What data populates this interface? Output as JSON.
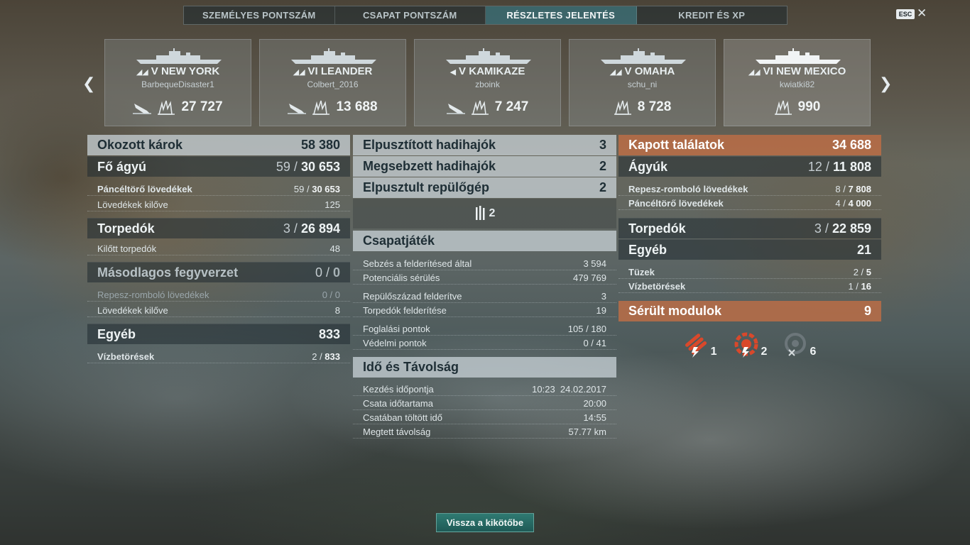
{
  "tabs": [
    {
      "label": "SZEMÉLYES PONTSZÁM",
      "active": false
    },
    {
      "label": "CSAPAT PONTSZÁM",
      "active": false
    },
    {
      "label": "RÉSZLETES JELENTÉS",
      "active": true
    },
    {
      "label": "KREDIT ÉS XP",
      "active": false
    }
  ],
  "esc_label": "ESC",
  "close_glyph": "✕",
  "ships": [
    {
      "tier": "V",
      "name": "NEW YORK",
      "player": "BarbequeDisaster1",
      "damage": "27 727",
      "sunk_icon": true,
      "class_icon": "battleship-icon"
    },
    {
      "tier": "VI",
      "name": "LEANDER",
      "player": "Colbert_2016",
      "damage": "13 688",
      "sunk_icon": true,
      "class_icon": "cruiser-icon"
    },
    {
      "tier": "V",
      "name": "KAMIKAZE",
      "player": "zboink",
      "damage": "7 247",
      "sunk_icon": true,
      "class_icon": "destroyer-icon"
    },
    {
      "tier": "V",
      "name": "OMAHA",
      "player": "schu_ni",
      "damage": "8 728",
      "sunk_icon": false,
      "class_icon": "cruiser-icon"
    },
    {
      "tier": "VI",
      "name": "NEW MEXICO",
      "player": "kwiatki82",
      "damage": "990",
      "sunk_icon": false,
      "class_icon": "battleship-icon"
    }
  ],
  "left": {
    "dealt": {
      "label": "Okozott károk",
      "value": "58 380"
    },
    "main_guns": {
      "label": "Fő ágyú",
      "hits": "59",
      "damage": "30 653"
    },
    "ap_shells": {
      "label": "Páncéltörő lövedékek",
      "hits": "59",
      "damage": "30 653"
    },
    "shells_fired": {
      "label": "Lövedékek kilőve",
      "value": "125"
    },
    "torpedoes": {
      "label": "Torpedók",
      "hits": "3",
      "damage": "26 894"
    },
    "torps_fired": {
      "label": "Kilőtt torpedók",
      "value": "48"
    },
    "secondary": {
      "label": "Másodlagos fegyverzet",
      "hits": "0",
      "damage": "0"
    },
    "he_shells": {
      "label": "Repesz-romboló lövedékek",
      "hits": "0",
      "damage": "0"
    },
    "sec_fired": {
      "label": "Lövedékek kilőve",
      "value": "8"
    },
    "other": {
      "label": "Egyéb",
      "value": "833"
    },
    "flooding": {
      "label": "Vízbetörések",
      "hits": "2",
      "damage": "833"
    }
  },
  "middle": {
    "ships_destroyed": {
      "label": "Elpusztított hadihajók",
      "value": "3"
    },
    "ships_damaged": {
      "label": "Megsebzett hadihajók",
      "value": "2"
    },
    "planes_destroyed": {
      "label": "Elpusztult repülőgép",
      "value": "2"
    },
    "plane_icon_count": "2",
    "teamplay": {
      "label": "Csapatjáték"
    },
    "spotting_damage": {
      "label": "Sebzés a felderítésed által",
      "value": "3 594"
    },
    "potential_damage": {
      "label": "Potenciális sérülés",
      "value": "479 769"
    },
    "squadrons_spotted": {
      "label": "Repülőszázad felderítve",
      "value": "3"
    },
    "torps_spotted": {
      "label": "Torpedók felderítése",
      "value": "19"
    },
    "capture_points": {
      "label": "Foglalási pontok",
      "value": "105 / 180"
    },
    "defense_points": {
      "label": "Védelmi pontok",
      "value": "0 / 41"
    },
    "time_distance": {
      "label": "Idő és Távolság"
    },
    "start_time": {
      "label": "Kezdés időpontja",
      "value": "10:23  24.02.2017"
    },
    "battle_duration": {
      "label": "Csata időtartama",
      "value": "20:00"
    },
    "time_in_battle": {
      "label": "Csatában töltött idő",
      "value": "14:55"
    },
    "distance": {
      "label": "Megtett távolság",
      "value": "57.77 km"
    }
  },
  "right": {
    "received": {
      "label": "Kapott találatok",
      "value": "34 688"
    },
    "guns": {
      "label": "Ágyúk",
      "hits": "12",
      "damage": "11 808"
    },
    "he_shells": {
      "label": "Repesz-romboló lövedékek",
      "hits": "8",
      "damage": "7 808"
    },
    "ap_shells": {
      "label": "Páncéltörő lövedékek",
      "hits": "4",
      "damage": "4 000"
    },
    "torpedoes": {
      "label": "Torpedók",
      "hits": "3",
      "damage": "22 859"
    },
    "other": {
      "label": "Egyéb",
      "value": "21"
    },
    "fires": {
      "label": "Tüzek",
      "hits": "2",
      "damage": "5"
    },
    "flooding": {
      "label": "Vízbetörések",
      "hits": "1",
      "damage": "16"
    },
    "modules": {
      "label": "Sérült modulok",
      "value": "9"
    },
    "module_icons": [
      {
        "icon": "torpedo-tubes-damaged-icon",
        "count": "1",
        "color": "#d9482b"
      },
      {
        "icon": "engine-damaged-icon",
        "count": "2",
        "color": "#d9482b"
      },
      {
        "icon": "module-destroyed-icon",
        "count": "6",
        "color": "#8d979b"
      }
    ]
  },
  "back_button": "Vissza a kikötőbe",
  "colors": {
    "accent_tab": "#468c96",
    "orange_header": "#be6e46",
    "button": "#2f7a72"
  }
}
